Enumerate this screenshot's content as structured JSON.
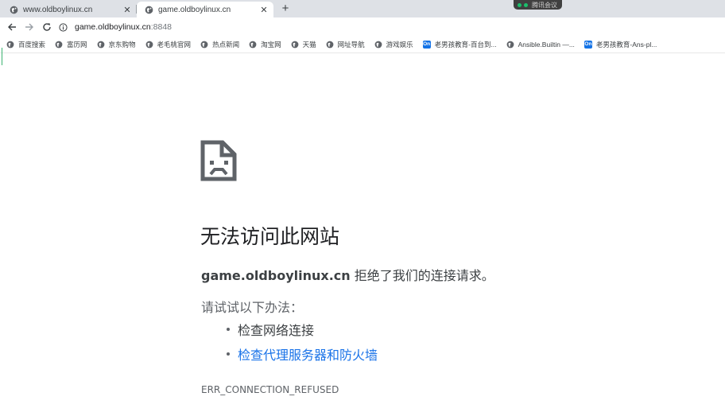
{
  "tabs": [
    {
      "title": "www.oldboylinux.cn",
      "icon": "globe-icon",
      "close": "✕",
      "active": false
    },
    {
      "title": "game.oldboylinux.cn",
      "icon": "globe-icon",
      "close": "✕",
      "active": true
    }
  ],
  "new_tab": "+",
  "meeting_badge": {
    "label": "腾讯会议"
  },
  "toolbar": {
    "back": "←",
    "forward": "→",
    "reload": "C",
    "url_host": "game.oldboylinux.cn",
    "url_port": ":8848"
  },
  "bookmarks": [
    {
      "label": "百度搜索",
      "icon": "globe-icon"
    },
    {
      "label": "富历网",
      "icon": "globe-icon"
    },
    {
      "label": "京东购物",
      "icon": "globe-icon"
    },
    {
      "label": "老毛桃官网",
      "icon": "globe-icon"
    },
    {
      "label": "热点新闻",
      "icon": "globe-icon"
    },
    {
      "label": "淘宝网",
      "icon": "globe-icon"
    },
    {
      "label": "天猫",
      "icon": "globe-icon"
    },
    {
      "label": "网址导航",
      "icon": "globe-icon"
    },
    {
      "label": "游戏娱乐",
      "icon": "globe-icon"
    },
    {
      "label": "老男孩教育-百台到...",
      "icon": "on-icon",
      "icon_text": "On"
    },
    {
      "label": "Ansible.Builtin —...",
      "icon": "globe-icon"
    },
    {
      "label": "老男孩教育-Ans-pl...",
      "icon": "on-icon",
      "icon_text": "On"
    }
  ],
  "error": {
    "title": "无法访问此网站",
    "domain": "game.oldboylinux.cn",
    "message_suffix": " 拒绝了我们的连接请求。",
    "try_label": "请试试以下办法：",
    "suggestions": [
      {
        "text": "检查网络连接",
        "link": false
      },
      {
        "text": "检查代理服务器和防火墙",
        "link": true
      }
    ],
    "code": "ERR_CONNECTION_REFUSED"
  },
  "colors": {
    "tabstrip": "#dee1e6",
    "link": "#1a73e8",
    "text": "#202124",
    "muted": "#5f6368",
    "on_icon": "#1473e6"
  }
}
